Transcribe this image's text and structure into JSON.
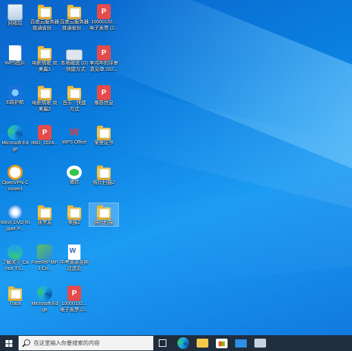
{
  "desktop": {
    "icons": [
      {
        "key": "recycle",
        "label": "回收站"
      },
      {
        "key": "f1",
        "label": "百度云服务器普通省份 ..."
      },
      {
        "key": "f2",
        "label": "百度云服务器普通省份 ..."
      },
      {
        "key": "p1",
        "label": "10000132... 电子发票 (2..."
      },
      {
        "key": "wps",
        "label": "WPS图片"
      },
      {
        "key": "f3",
        "label": "电影情歌 欢 美篇1"
      },
      {
        "key": "drive",
        "label": "本地磁盘 (D) - 快捷方式"
      },
      {
        "key": "p2",
        "label": "李鸿年的评审 意见单 202..."
      },
      {
        "key": "ietf",
        "label": "E路护航"
      },
      {
        "key": "f4",
        "label": "电影情歌 欢 美篇2"
      },
      {
        "key": "f5",
        "label": "音乐 - 快捷 方式"
      },
      {
        "key": "p3",
        "label": "推荐信息"
      },
      {
        "key": "edge1",
        "label": "Microsoft Edge"
      },
      {
        "key": "p4",
        "label": "IMG_2024..."
      },
      {
        "key": "wpsoffice",
        "label": "WPS Office"
      },
      {
        "key": "f6",
        "label": "荣誉证书"
      },
      {
        "key": "openvpn",
        "label": "OpenVPN Connect"
      },
      {
        "key": "wechat",
        "label": "微信"
      },
      {
        "key": "f7",
        "label": "照片扫描2"
      },
      {
        "key": "winx",
        "label": "WinX DVD Ripper P..."
      },
      {
        "key": "f8",
        "label": "张学友"
      },
      {
        "key": "f9",
        "label": "卖报2"
      },
      {
        "key": "f10",
        "label": "照片扫描"
      },
      {
        "key": "canon",
        "label": "了解关于 Canon TS..."
      },
      {
        "key": "freerip",
        "label": "FreeRIP MP3 Co..."
      },
      {
        "key": "word",
        "label": "中考滚滚名称 过滤及"
      },
      {
        "key": "f11",
        "label": "Track"
      },
      {
        "key": "edge2",
        "label": "Microsoft Edge"
      },
      {
        "key": "p5",
        "label": "10000132... 电子发票 (2..."
      }
    ]
  },
  "taskbar": {
    "search_placeholder": "在这里输入你要搜索的内容",
    "pinned": [
      "task-view",
      "edge",
      "file-explorer",
      "store",
      "mail",
      "network"
    ]
  }
}
